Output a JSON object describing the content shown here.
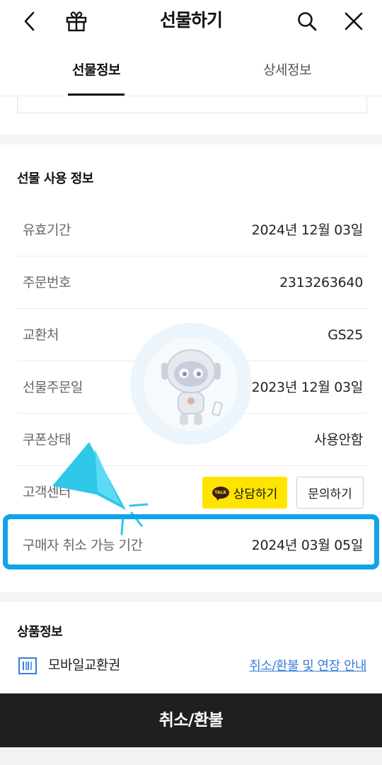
{
  "header": {
    "title": "선물하기",
    "back_icon": "chevron-left-icon",
    "gift_icon": "gift-icon",
    "search_icon": "search-icon",
    "close_icon": "close-icon"
  },
  "tabs": [
    {
      "label": "선물정보",
      "active": true
    },
    {
      "label": "상세정보",
      "active": false
    }
  ],
  "gift_usage": {
    "title": "선물 사용 정보",
    "rows": [
      {
        "label": "유효기간",
        "value": "2024년 12월 03일"
      },
      {
        "label": "주문번호",
        "value": "2313263640"
      },
      {
        "label": "교환처",
        "value": "GS25"
      },
      {
        "label": "선물주문일",
        "value": "2023년 12월 03일"
      },
      {
        "label": "쿠폰상태",
        "value": "사용안함"
      }
    ],
    "customer_row": {
      "label": "고객센터",
      "talk_button": "상담하기",
      "talk_badge": "TALK",
      "inquiry_button": "문의하기"
    },
    "cancel_row": {
      "label": "구매자 취소 가능 기간",
      "value": "2024년 03월 05일"
    }
  },
  "product_info": {
    "title": "상품정보",
    "item_name": "모바일교환권",
    "link_text": "취소/환불 및 연장 안내"
  },
  "bottom_button": {
    "label": "취소/환불"
  },
  "colors": {
    "highlight": "#0fa3ec",
    "kakao_yellow": "#fee500",
    "link_blue": "#3b7dd8",
    "bottom_bar": "#1f1f1f"
  }
}
